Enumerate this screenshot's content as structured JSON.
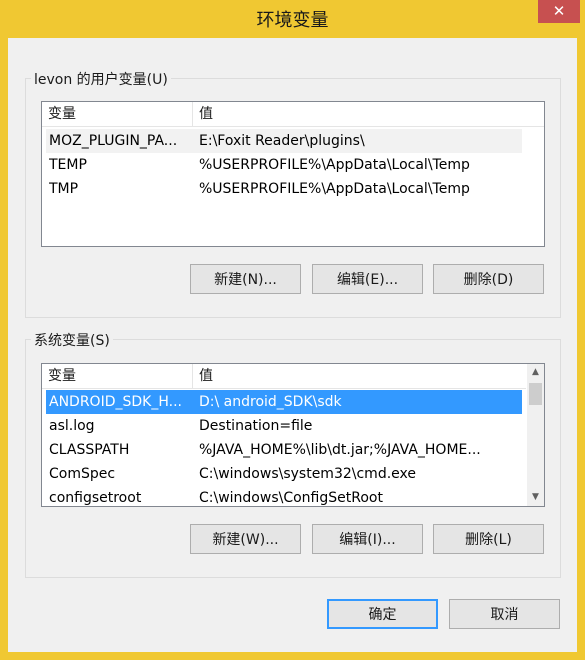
{
  "window": {
    "title": "环境变量",
    "close_glyph": "✕"
  },
  "user_vars": {
    "group_label": "levon 的用户变量(U)",
    "headers": [
      "变量",
      "值"
    ],
    "rows": [
      {
        "name": "MOZ_PLUGIN_PA...",
        "value": "E:\\Foxit Reader\\plugins\\"
      },
      {
        "name": "TEMP",
        "value": "%USERPROFILE%\\AppData\\Local\\Temp"
      },
      {
        "name": "TMP",
        "value": "%USERPROFILE%\\AppData\\Local\\Temp"
      }
    ],
    "buttons": {
      "new": "新建(N)...",
      "edit": "编辑(E)...",
      "delete": "删除(D)"
    }
  },
  "system_vars": {
    "group_label": "系统变量(S)",
    "headers": [
      "变量",
      "值"
    ],
    "rows": [
      {
        "name": "ANDROID_SDK_H...",
        "value": "D:\\ android_SDK\\sdk"
      },
      {
        "name": "asl.log",
        "value": "Destination=file"
      },
      {
        "name": "CLASSPATH",
        "value": "%JAVA_HOME%\\lib\\dt.jar;%JAVA_HOME..."
      },
      {
        "name": "ComSpec",
        "value": "C:\\windows\\system32\\cmd.exe"
      },
      {
        "name": "configsetroot",
        "value": "C:\\windows\\ConfigSetRoot"
      }
    ],
    "buttons": {
      "new": "新建(W)...",
      "edit": "编辑(I)...",
      "delete": "删除(L)"
    }
  },
  "footer": {
    "ok": "确定",
    "cancel": "取消"
  },
  "colors": {
    "frame": "#f0c832",
    "selection": "#3399ff",
    "close": "#c75050"
  }
}
